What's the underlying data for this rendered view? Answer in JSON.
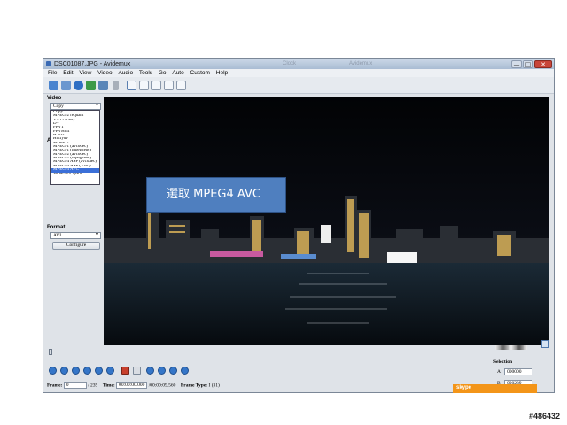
{
  "window": {
    "title": "DSC01087.JPG - Avidemux",
    "faded_title_1": "Clock",
    "faded_title_2": "Avidemux",
    "controls": {
      "minimize": "—",
      "maximize": "□",
      "close": "✕"
    }
  },
  "menu": [
    "File",
    "Edit",
    "View",
    "Video",
    "Audio",
    "Tools",
    "Go",
    "Auto",
    "Custom",
    "Help"
  ],
  "toolbar": {
    "icons": [
      "open-icon",
      "open-append-icon",
      "info-icon",
      "save-icon",
      "save-image-icon",
      "calculator-icon",
      "preview-input-icon",
      "preview-output-icon",
      "side-by-side-icon",
      "top-bottom-icon",
      "separate-icon"
    ]
  },
  "left_panel": {
    "video_label": "Video",
    "video_selected": "Copy",
    "audio_label": "Au",
    "format_label": "Format",
    "format_selected": "AVI",
    "configure_label": "Configure",
    "codec_options": [
      "Copy",
      "MPEG-2 requant",
      "YV12 (raw)",
      "DV",
      "FFV1",
      "FFVHuff",
      "H.263",
      "Huffyuv",
      "M-JPEG",
      "MPEG-1 (avcodec)",
      "MPEG-1 (mpeg2enc)",
      "MPEG-2 (avcodec)",
      "MPEG-2 (mpeg2enc)",
      "MPEG-4 ASP (avcodec)",
      "MPEG-4 ASP (Xvid)",
      "MPEG-4 AVC",
      "Snow/ava 2path"
    ],
    "highlighted_index": 15
  },
  "callout": {
    "text": "選取 MPEG4 AVC",
    "color": "#4f7fbf"
  },
  "status_bar": {
    "frame_label": "Frame:",
    "frame_value": "0",
    "frame_total": "/ 239",
    "time_label": "Time:",
    "time_value": "00:00:00.000",
    "time_total": "/00:00:09.560",
    "frame_type_label": "Frame Type:",
    "frame_type_value": "I (31)"
  },
  "selection": {
    "label": "Selection",
    "a_label": "A:",
    "a_value": "000000",
    "b_label": "B:",
    "b_value": "000239"
  },
  "notice_label": "skype",
  "watermark": "#486432",
  "colors": {
    "accent": "#3576c8",
    "highlight": "#3b6fd8",
    "notice": "#f39519"
  }
}
